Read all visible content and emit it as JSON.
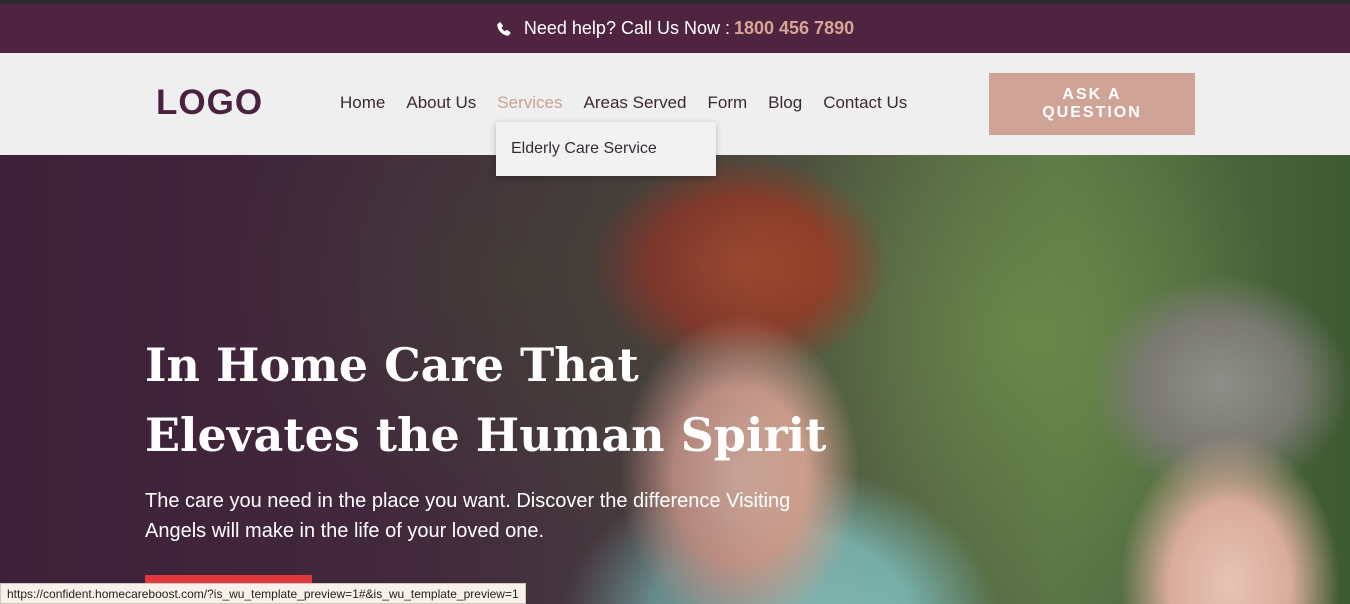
{
  "help_bar": {
    "text": "Need help? Call Us Now :",
    "phone": "1800 456 7890",
    "icon": "phone-icon"
  },
  "header": {
    "logo": "LOGO",
    "nav": [
      {
        "label": "Home",
        "active": false
      },
      {
        "label": "About Us",
        "active": false
      },
      {
        "label": "Services",
        "active": true
      },
      {
        "label": "Areas Served",
        "active": false
      },
      {
        "label": "Form",
        "active": false
      },
      {
        "label": "Blog",
        "active": false
      },
      {
        "label": "Contact Us",
        "active": false
      }
    ],
    "cta_label": "ASK A QUESTION"
  },
  "dropdown": {
    "items": [
      "Elderly Care Service"
    ]
  },
  "hero": {
    "title_line1": "In Home Care That",
    "title_line2": "Elevates the Human Spirit",
    "subtitle": "The care you need in the place you want. Discover the difference Visiting Angels will make in the life of your loved one."
  },
  "status_bar": {
    "url": "https://confident.homecareboost.com/?is_wu_template_preview=1#&is_wu_template_preview=1"
  },
  "colors": {
    "help_bar_bg": "#4e2440",
    "accent": "#cfa396",
    "phone_number": "#d8a496",
    "logo": "#4a2140",
    "hero_cta": "#e03a3e"
  }
}
